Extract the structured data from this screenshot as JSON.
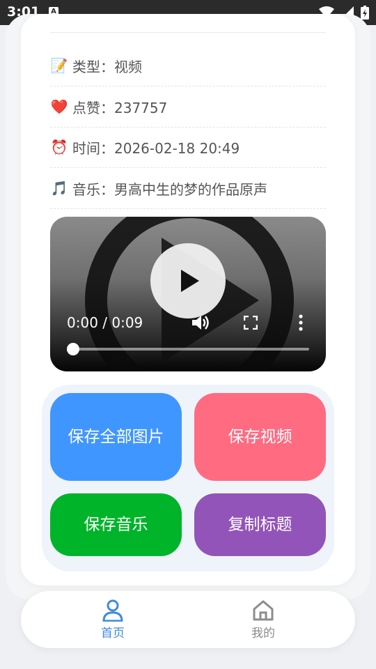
{
  "status_bar": {
    "time": "3:01",
    "notif_icon": "A"
  },
  "info": {
    "type": {
      "emoji": "📝",
      "label": "类型：",
      "value": "视频"
    },
    "likes": {
      "emoji": "❤️",
      "label": "点赞：",
      "value": "237757"
    },
    "time": {
      "emoji": "⏰",
      "label": "时间：",
      "value": "2026-02-18 20:49"
    },
    "music": {
      "emoji": "🎵",
      "label": "音乐：",
      "value": "男高中生的梦的作品原声"
    }
  },
  "video": {
    "time_display": "0:00 / 0:09",
    "progress": 0.0
  },
  "actions": {
    "save_all_images": "保存全部图片",
    "save_video": "保存视频",
    "save_music": "保存音乐",
    "copy_title": "复制标题"
  },
  "colors": {
    "blue": "#4096ff",
    "pink": "#ff6b81",
    "green": "#00b42a",
    "purple": "#9254b8",
    "nav_active": "#3f8ae0",
    "nav_inactive": "#8c8c8c"
  },
  "nav": {
    "home": {
      "label": "首页",
      "icon": "person-icon",
      "active": true
    },
    "mine": {
      "label": "我的",
      "icon": "home-icon",
      "active": false
    }
  }
}
